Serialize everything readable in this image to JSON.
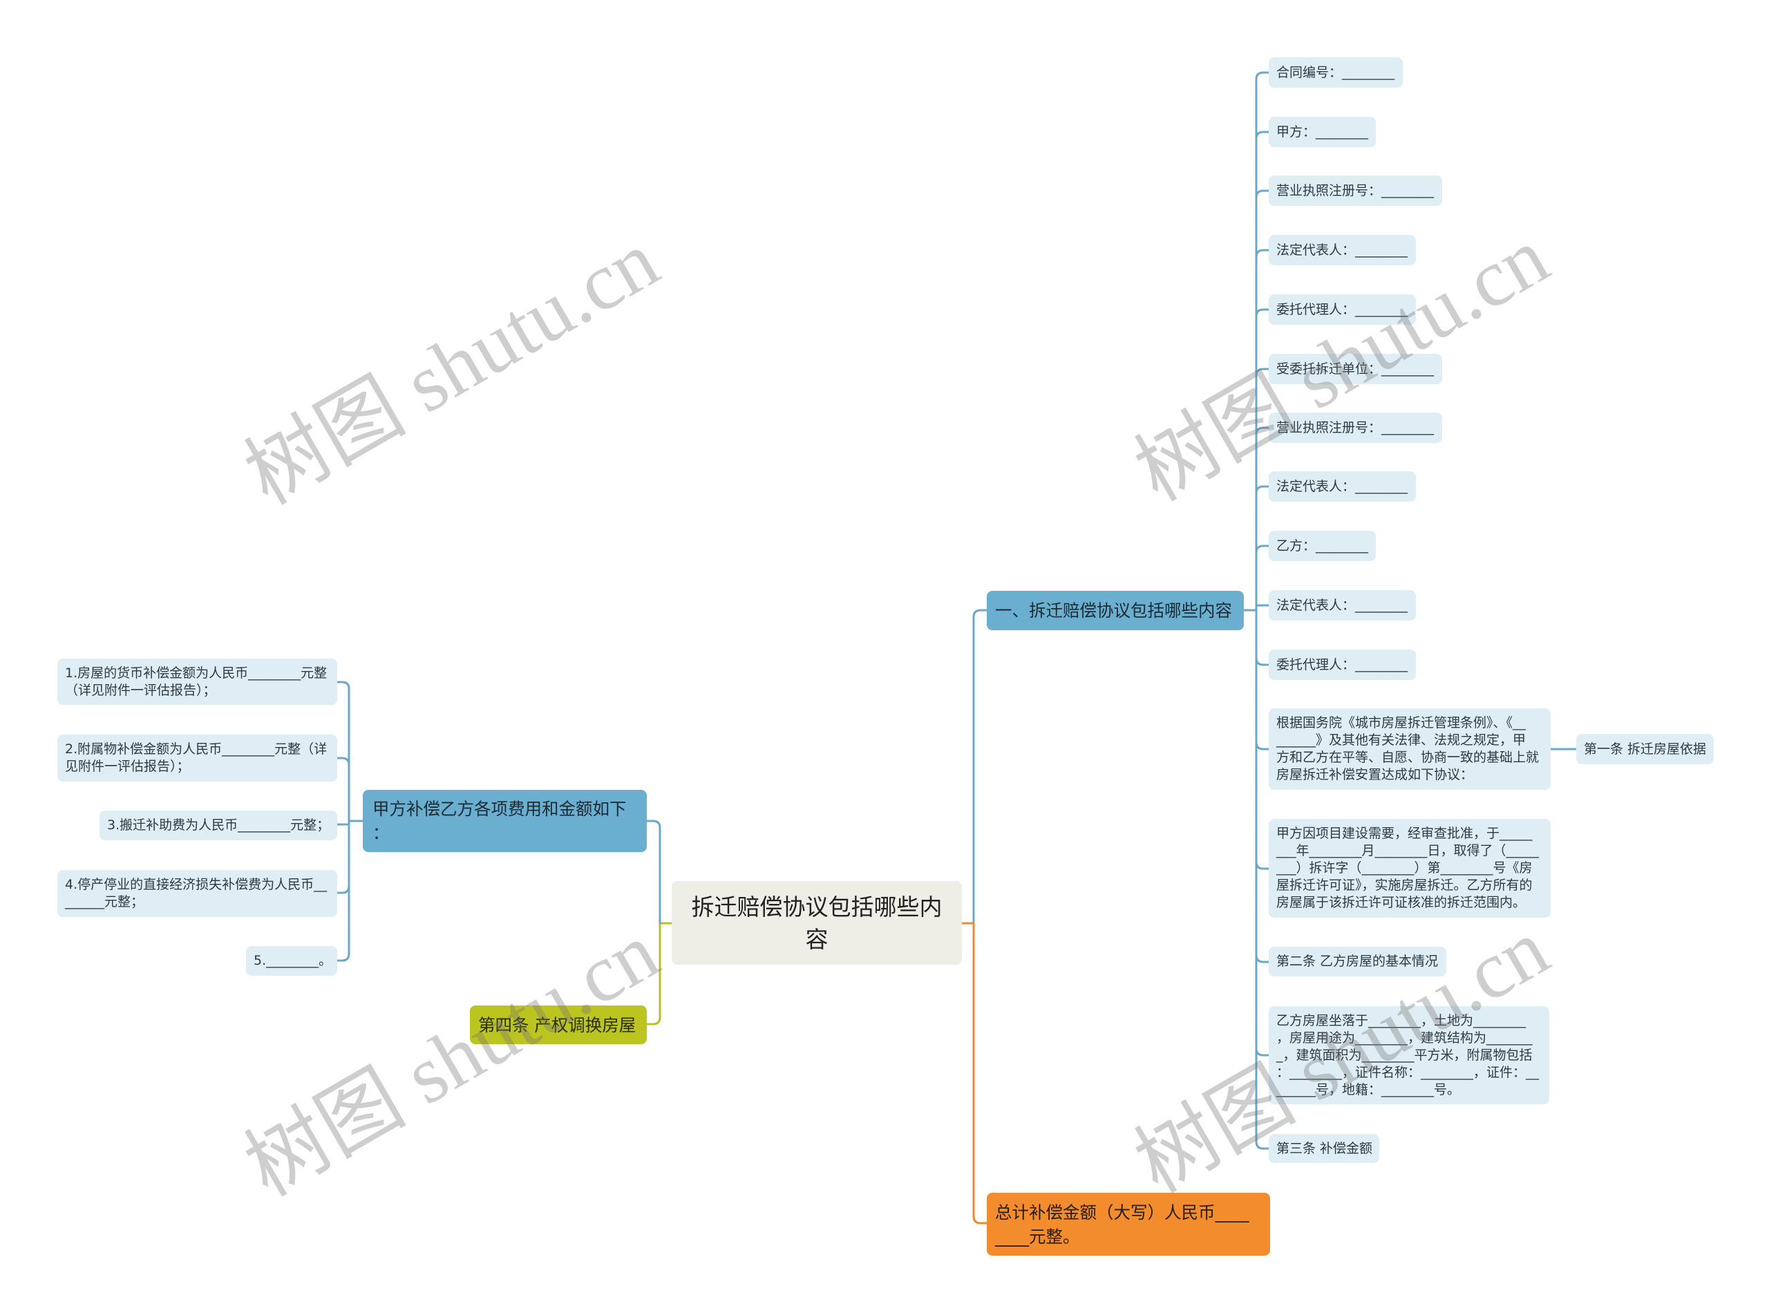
{
  "colors": {
    "root_bg": "#EFEEE6",
    "blue_node": "#6AAED0",
    "blue_line": "#6AA7C9",
    "leaf_bg": "#DFEDF5",
    "orange": "#F28C2C",
    "orange_line": "#EE8A2C",
    "olive": "#BCC41F",
    "olive_line": "#B8C11F",
    "text_dark": "#2D3A41"
  },
  "root": {
    "label": "拆迁赔偿协议包括哪些内\n容"
  },
  "right_branch": {
    "label": "一、拆迁赔偿协议包括哪些内容",
    "children": [
      {
        "text": "合同编号：________"
      },
      {
        "text": "甲方：________"
      },
      {
        "text": "营业执照注册号：________"
      },
      {
        "text": "法定代表人：________"
      },
      {
        "text": "委托代理人：________"
      },
      {
        "text": "受委托拆迁单位：________"
      },
      {
        "text": "营业执照注册号：________"
      },
      {
        "text": "法定代表人：________"
      },
      {
        "text": "乙方：________"
      },
      {
        "text": "法定代表人：________"
      },
      {
        "text": "委托代理人：________"
      },
      {
        "text": "根据国务院《城市房屋拆迁管理条例》、《__\n______》及其他有关法律、法规之规定，甲\n方和乙方在平等、自愿、协商一致的基础上就\n房屋拆迁补偿安置达成如下协议：",
        "children": [
          {
            "text": "第一条 拆迁房屋依据"
          }
        ]
      },
      {
        "text": "甲方因项目建设需要，经审查批准，于_____\n___年________月________日，取得了（_____\n___）拆许字（________）第________号《房\n屋拆迁许可证》，实施房屋拆迁。乙方所有的\n房屋属于该拆迁许可证核准的拆迁范围内。"
      },
      {
        "text": "第二条 乙方房屋的基本情况"
      },
      {
        "text": "乙方房屋坐落于________，土地为________\n，房屋用途为________，建筑结构为_______\n_，建筑面积为________平方米，附属物包括\n：________，证件名称：________，证件：__\n______号，地籍：________号。"
      },
      {
        "text": "第三条 补偿金额"
      }
    ]
  },
  "total_node": {
    "label": "总计补偿金额（大写）人民币____\n____元整。"
  },
  "left_branch": {
    "label": "甲方补偿乙方各项费用和金额如下\n：",
    "children": [
      {
        "text": "1.房屋的货币补偿金额为人民币________元整\n（详见附件一评估报告）；"
      },
      {
        "text": "2.附属物补偿金额为人民币________元整（详\n见附件一评估报告）；"
      },
      {
        "text": "3.搬迁补助费为人民币________元整；"
      },
      {
        "text": "4.停产停业的直接经济损失补偿费为人民币__\n______元整；"
      },
      {
        "text": "5.________。"
      }
    ]
  },
  "article4_node": {
    "label": "第四条 产权调换房屋"
  },
  "watermark": {
    "text": "树图 shutu.cn"
  }
}
